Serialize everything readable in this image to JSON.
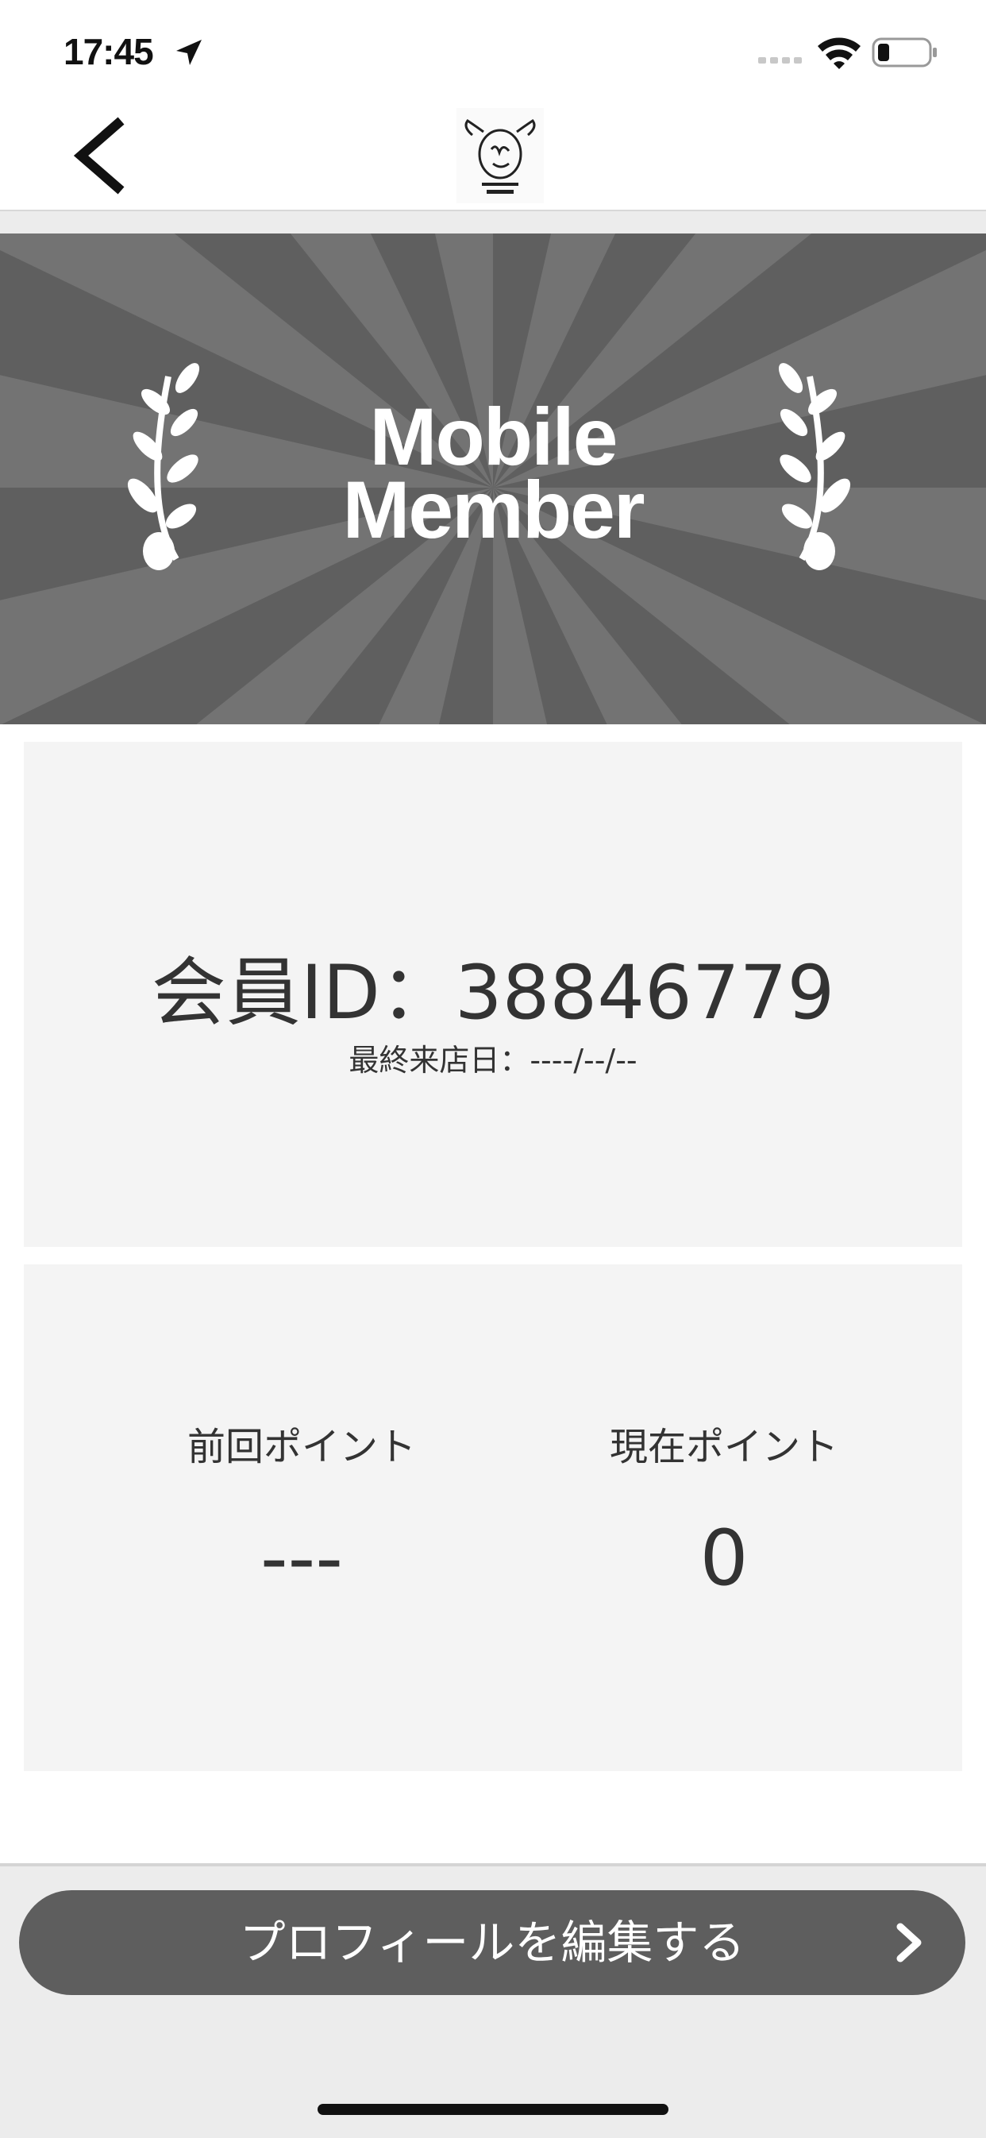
{
  "status_bar": {
    "time": "17:45",
    "icons": [
      "location-arrow-icon",
      "cellular-signal-icon",
      "wifi-icon",
      "battery-icon"
    ]
  },
  "nav": {
    "back_icon": "chevron-left-icon",
    "logo": "horitan-cow-logo"
  },
  "banner": {
    "title_line1": "Mobile",
    "title_line2": "Member",
    "decoration": "laurel-icon"
  },
  "member_card": {
    "member_id": "会員ID：38846779",
    "last_visit": "最終来店日：----/--/--"
  },
  "points": {
    "previous_label": "前回ポイント",
    "previous_value": "---",
    "current_label": "現在ポイント",
    "current_value": "0"
  },
  "actions": {
    "edit_profile_label": "プロフィールを編集する",
    "edit_profile_icon": "chevron-right-icon"
  },
  "colors": {
    "banner": "#5f5f5f",
    "card": "#f4f4f4",
    "button": "#5e5e5e",
    "text": "#333333"
  }
}
